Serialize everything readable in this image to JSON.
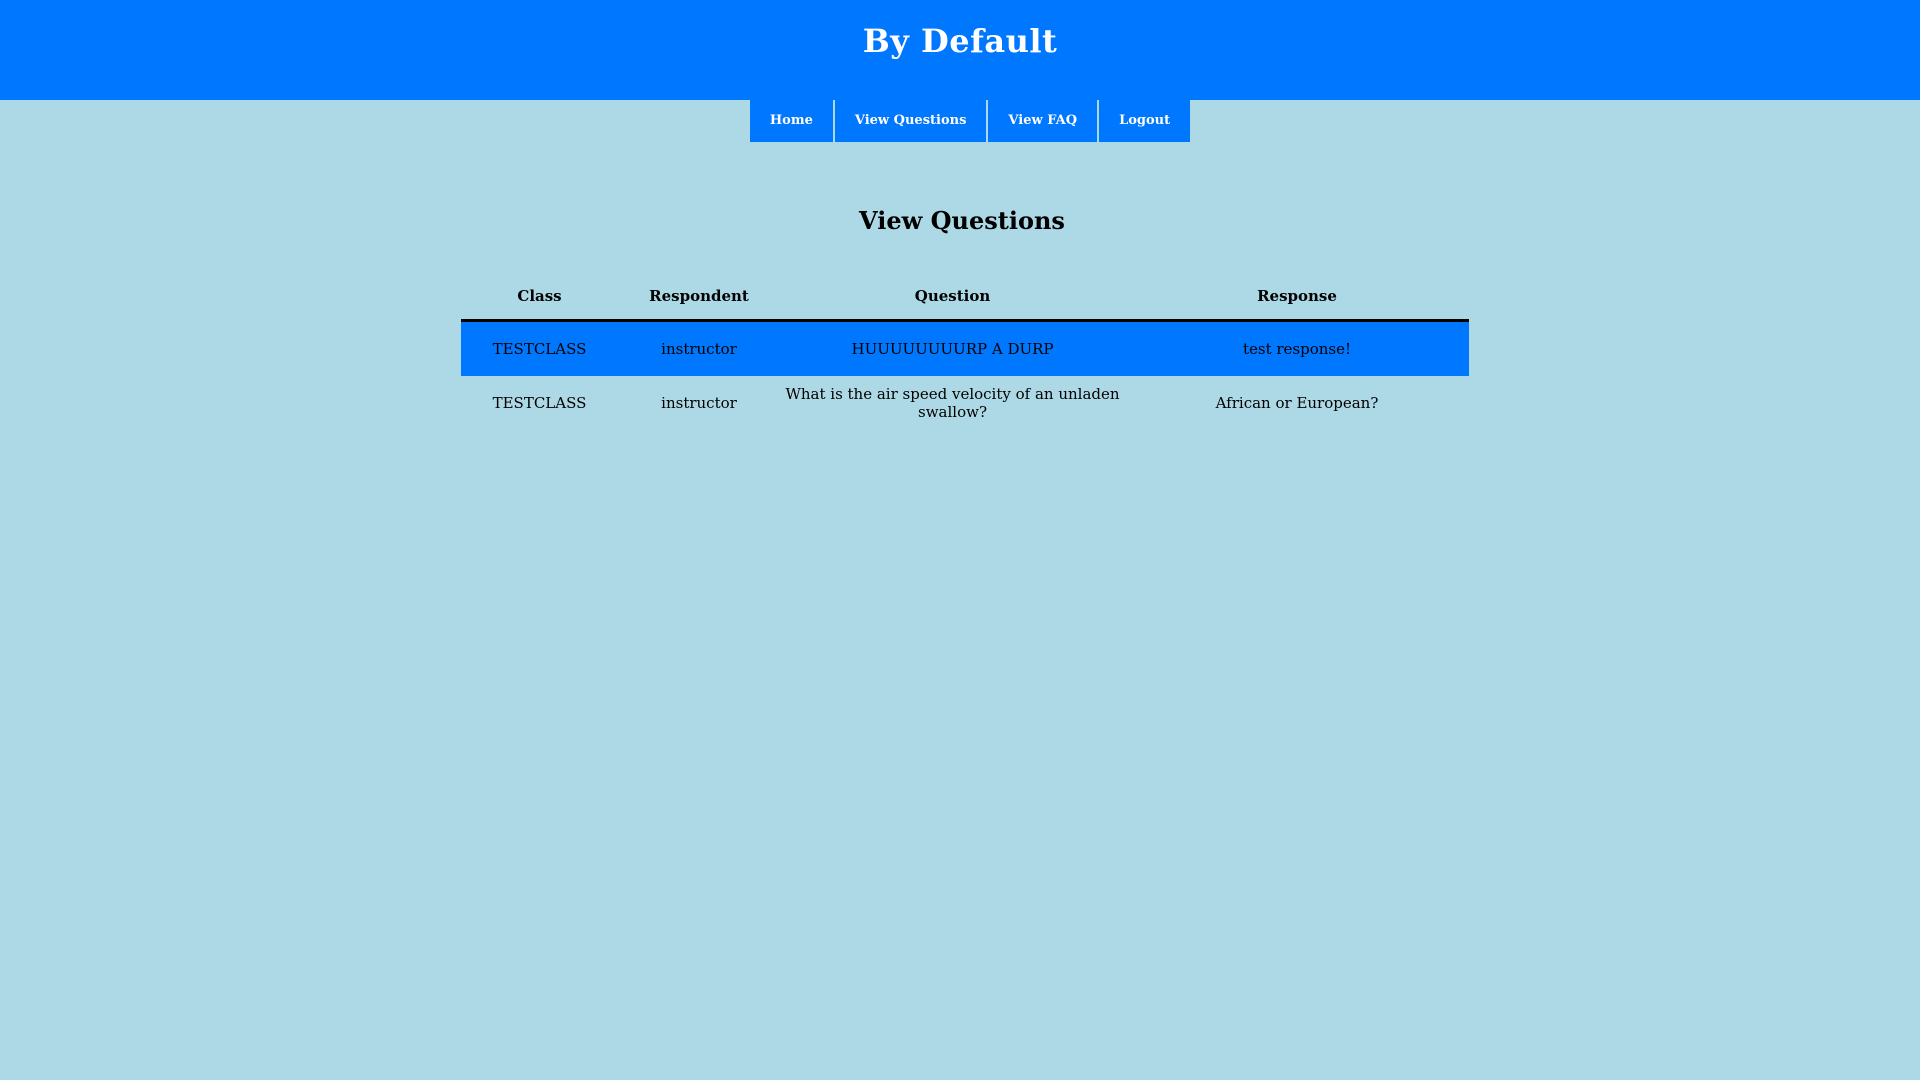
{
  "header": {
    "title": "By Default"
  },
  "nav": {
    "items": [
      {
        "label": "Home"
      },
      {
        "label": "View Questions"
      },
      {
        "label": "View FAQ"
      },
      {
        "label": "Logout"
      }
    ]
  },
  "main": {
    "title": "View Questions",
    "table": {
      "columns": [
        "Class",
        "Respondent",
        "Question",
        "Response"
      ],
      "rows": [
        {
          "class": "TESTCLASS",
          "respondent": "instructor",
          "question": "HUUUUUUUURP A DURP",
          "response": "test response!",
          "highlighted": true
        },
        {
          "class": "TESTCLASS",
          "respondent": "instructor",
          "question": "What is the air speed velocity of an unladen swallow?",
          "response": "African or European?",
          "highlighted": false
        }
      ]
    }
  },
  "colors": {
    "brand_blue": "#0077ff",
    "page_background": "#add8e6",
    "header_text": "#ffffff"
  }
}
